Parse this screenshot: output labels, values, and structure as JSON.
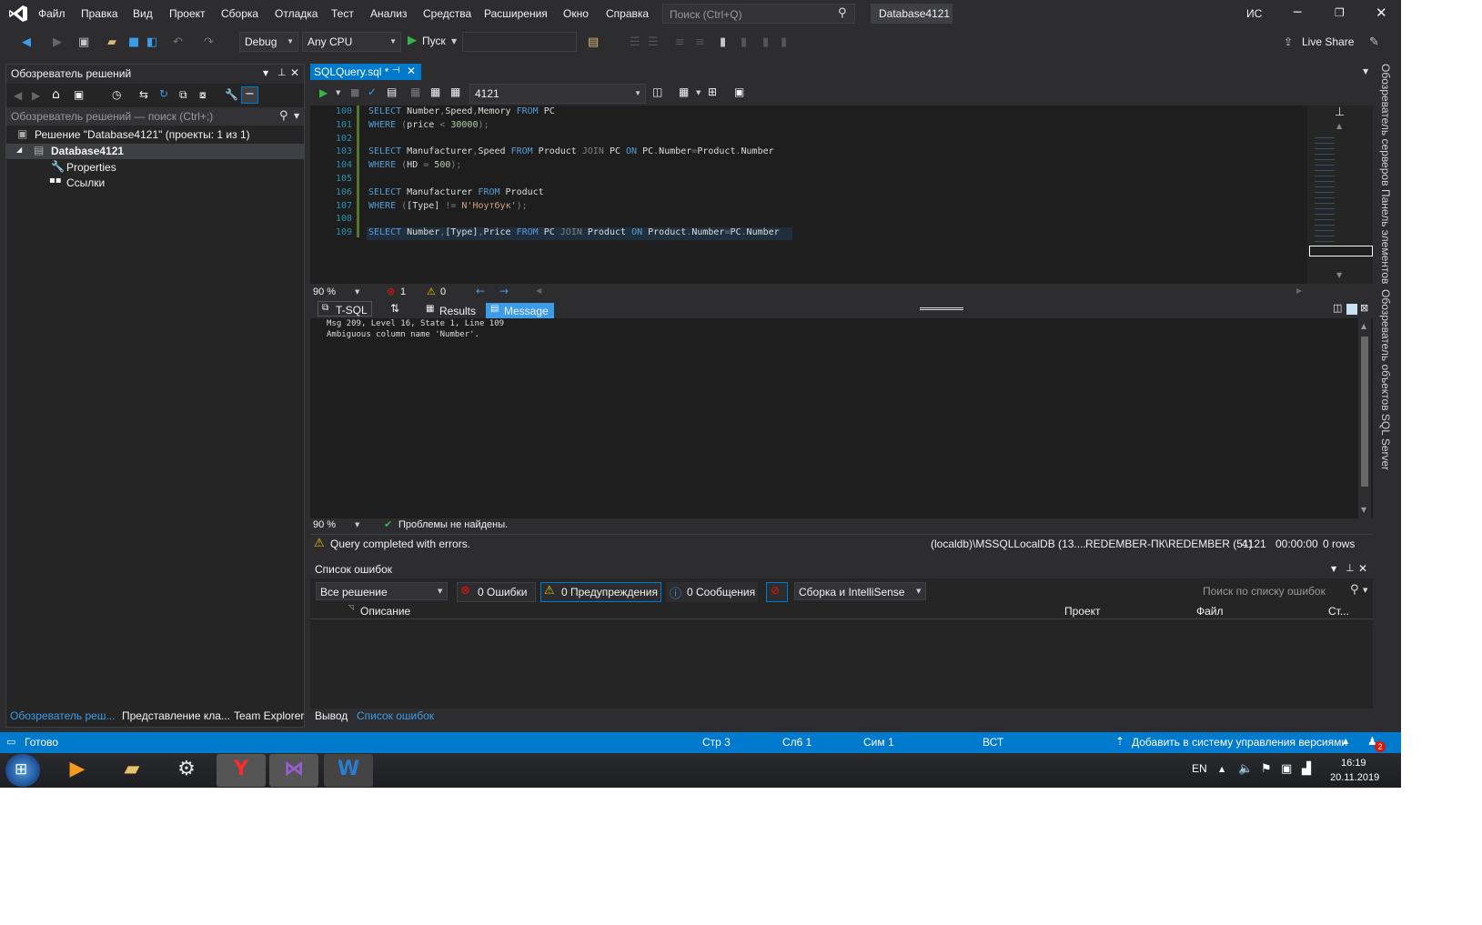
{
  "menu": {
    "items": [
      "Файл",
      "Правка",
      "Вид",
      "Проект",
      "Сборка",
      "Отладка",
      "Тест",
      "Анализ",
      "Средства",
      "Расширения",
      "Окно",
      "Справка"
    ],
    "search_placeholder": "Поиск (Ctrl+Q)",
    "solution_name": "Database4121",
    "user_initials": "ИС"
  },
  "toolbar": {
    "config": "Debug",
    "platform": "Any CPU",
    "start_label": "Пуск",
    "live_share": "Live Share"
  },
  "solution_explorer": {
    "title": "Обозреватель решений",
    "search_placeholder": "Обозреватель решений — поиск (Ctrl+;)",
    "solution_label": "Решение \"Database4121\" (проекты: 1 из 1)",
    "project": "Database4121",
    "children": [
      "Properties",
      "Ссылки"
    ]
  },
  "left_bottom_tabs": [
    "Обозреватель реш...",
    "Представление кла...",
    "Team Explorer"
  ],
  "editor": {
    "tab_label": "SQLQuery.sql *",
    "database": "4121",
    "zoom": "90 %",
    "errors": "1",
    "warnings": "0",
    "line_numbers": [
      "100",
      "101",
      "102",
      "103",
      "104",
      "105",
      "106",
      "107",
      "108",
      "109"
    ]
  },
  "results": {
    "tabs": [
      "T-SQL",
      "Results",
      "Message"
    ],
    "message_lines": [
      "Msg 209, Level 16, State 1, Line 109",
      "Ambiguous column name 'Number'."
    ],
    "zoom": "90 %",
    "problems": "Проблемы не найдены."
  },
  "query_status": {
    "message": "Query completed with errors.",
    "server": "(localdb)\\MSSQLLocalDB (13....",
    "user": "REDEMBER-ПК\\REDEMBER (51)",
    "db": "4121",
    "time": "00:00:00",
    "rows": "0 rows"
  },
  "error_list": {
    "title": "Список ошибок",
    "scope": "Все решение",
    "errors": "0 Ошибки",
    "warnings": "0 Предупреждения",
    "messages": "0 Сообщения",
    "build_filter": "Сборка и IntelliSense",
    "search_placeholder": "Поиск по списку ошибок",
    "columns": [
      "Описание",
      "Проект",
      "Файл",
      "Ст..."
    ]
  },
  "bottom_tabs": [
    "Вывод",
    "Список ошибок"
  ],
  "right_tabs": [
    "Обозреватель серверов",
    "Панель элементов",
    "Обозреватель объектов SQL Server"
  ],
  "statusbar": {
    "ready": "Готово",
    "line": "Стр 3",
    "col": "Сл6 1",
    "ch": "Сим 1",
    "mode": "ВСТ",
    "source_control": "Добавить в систему управления версиями",
    "notifications": "2"
  },
  "taskbar": {
    "lang": "EN",
    "time": "16:19",
    "date": "20.11.2019"
  },
  "colors": {
    "accent": "#007acc",
    "background": "#2d2d30",
    "editor": "#1e1e1e",
    "keyword": "#569cd6"
  }
}
